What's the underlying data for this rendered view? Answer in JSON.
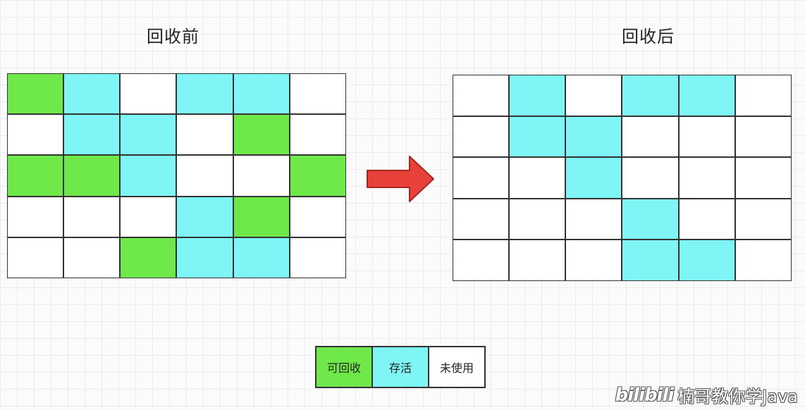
{
  "before": {
    "title": "回收前",
    "rows": [
      [
        "reclaimable",
        "alive",
        "unused",
        "alive",
        "alive",
        "unused"
      ],
      [
        "unused",
        "alive",
        "alive",
        "unused",
        "reclaimable",
        "unused"
      ],
      [
        "reclaimable",
        "reclaimable",
        "alive",
        "unused",
        "unused",
        "reclaimable"
      ],
      [
        "unused",
        "unused",
        "unused",
        "alive",
        "reclaimable",
        "unused"
      ],
      [
        "unused",
        "unused",
        "reclaimable",
        "alive",
        "alive",
        "unused"
      ]
    ]
  },
  "after": {
    "title": "回收后",
    "rows": [
      [
        "unused",
        "alive",
        "unused",
        "alive",
        "alive",
        "unused"
      ],
      [
        "unused",
        "alive",
        "alive",
        "unused",
        "unused",
        "unused"
      ],
      [
        "unused",
        "unused",
        "alive",
        "unused",
        "unused",
        "unused"
      ],
      [
        "unused",
        "unused",
        "unused",
        "alive",
        "unused",
        "unused"
      ],
      [
        "unused",
        "unused",
        "unused",
        "alive",
        "alive",
        "unused"
      ]
    ]
  },
  "legend": [
    {
      "key": "reclaimable",
      "label": "可回收",
      "color": "#6fe84a"
    },
    {
      "key": "alive",
      "label": "存活",
      "color": "#7ff5f5"
    },
    {
      "key": "unused",
      "label": "未使用",
      "color": "#ffffff"
    }
  ],
  "colors": {
    "arrow": "#e8413a",
    "grid_border": "#333333"
  },
  "watermark": {
    "logo": "bilibili",
    "text": "楠哥教你学Java"
  }
}
